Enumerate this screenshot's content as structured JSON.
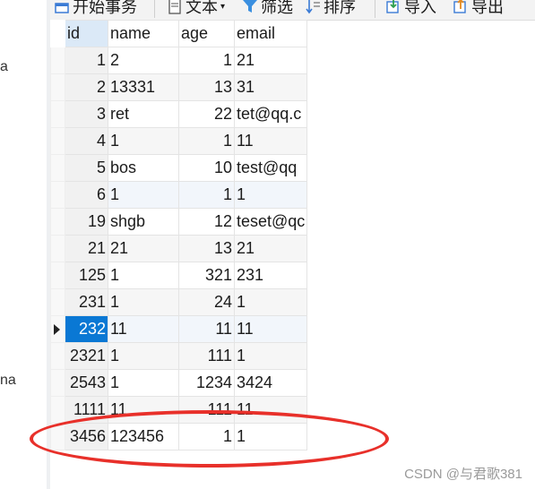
{
  "toolbar": {
    "begin_transaction": "开始事务",
    "text": "文本",
    "filter": "筛选",
    "sort": "排序",
    "import": "导入",
    "export": "导出"
  },
  "sidebar": {
    "fragment_1": "a",
    "fragment_2": "na"
  },
  "grid": {
    "columns": [
      "id",
      "name",
      "age",
      "email"
    ],
    "rows": [
      {
        "id": "1",
        "name": "2",
        "age": "1",
        "email": "21"
      },
      {
        "id": "2",
        "name": "13331",
        "age": "13",
        "email": "31"
      },
      {
        "id": "3",
        "name": "ret",
        "age": "22",
        "email": "tet@qq.c"
      },
      {
        "id": "4",
        "name": "1",
        "age": "1",
        "email": "11"
      },
      {
        "id": "5",
        "name": "bos",
        "age": "10",
        "email": "test@qq"
      },
      {
        "id": "6",
        "name": "1",
        "age": "1",
        "email": "1"
      },
      {
        "id": "19",
        "name": "shgb",
        "age": "12",
        "email": "teset@qc"
      },
      {
        "id": "21",
        "name": "21",
        "age": "13",
        "email": "21"
      },
      {
        "id": "125",
        "name": "1",
        "age": "321",
        "email": "231"
      },
      {
        "id": "231",
        "name": "1",
        "age": "24",
        "email": "1"
      },
      {
        "id": "232",
        "name": "11",
        "age": "11",
        "email": "11"
      },
      {
        "id": "2321",
        "name": "1",
        "age": "111",
        "email": "1"
      },
      {
        "id": "2543",
        "name": "1",
        "age": "1234",
        "email": "3424"
      },
      {
        "id": "1111",
        "name": "11",
        "age": "111",
        "email": "11"
      },
      {
        "id": "3456",
        "name": "123456",
        "age": "1",
        "email": "1"
      }
    ],
    "current_row_id": "232"
  },
  "watermark": "CSDN @与君歌381",
  "colors": {
    "selection": "#0a78d4",
    "annotation_ellipse": "#e8302a",
    "header_highlight": "#dbe9f7"
  }
}
